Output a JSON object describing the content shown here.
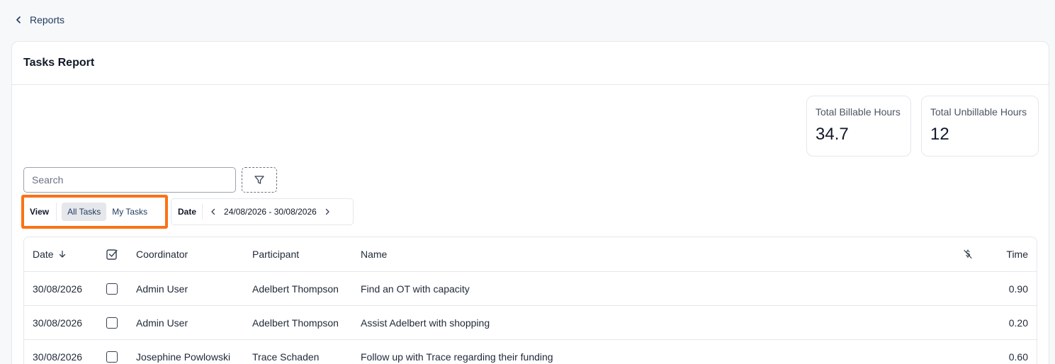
{
  "nav": {
    "back_label": "Reports"
  },
  "report": {
    "title": "Tasks Report"
  },
  "stats": [
    {
      "label": "Total Billable Hours",
      "value": "34.7"
    },
    {
      "label": "Total Unbillable Hours",
      "value": "12"
    }
  ],
  "search": {
    "placeholder": "Search",
    "value": ""
  },
  "view": {
    "label": "View",
    "options": [
      "All Tasks",
      "My Tasks"
    ],
    "selected": "All Tasks"
  },
  "date": {
    "label": "Date",
    "range": "24/08/2026 - 30/08/2026"
  },
  "table": {
    "columns": {
      "date": "Date",
      "coordinator": "Coordinator",
      "participant": "Participant",
      "name": "Name",
      "time": "Time"
    },
    "rows": [
      {
        "date": "30/08/2026",
        "coordinator": "Admin User",
        "participant": "Adelbert Thompson",
        "name": "Find an OT with capacity",
        "time": "0.90"
      },
      {
        "date": "30/08/2026",
        "coordinator": "Admin User",
        "participant": "Adelbert Thompson",
        "name": "Assist Adelbert with shopping",
        "time": "0.20"
      },
      {
        "date": "30/08/2026",
        "coordinator": "Josephine Powlowski",
        "participant": "Trace Schaden",
        "name": "Follow up with Trace regarding their funding",
        "time": "0.60"
      }
    ]
  },
  "colors": {
    "highlight": "#f97316",
    "link": "#1e3a5f",
    "border": "#e5e7eb"
  },
  "icons": [
    "chevron-left-icon",
    "filter-icon",
    "sort-down-icon",
    "checkbox-checked-icon",
    "billable-off-icon"
  ]
}
